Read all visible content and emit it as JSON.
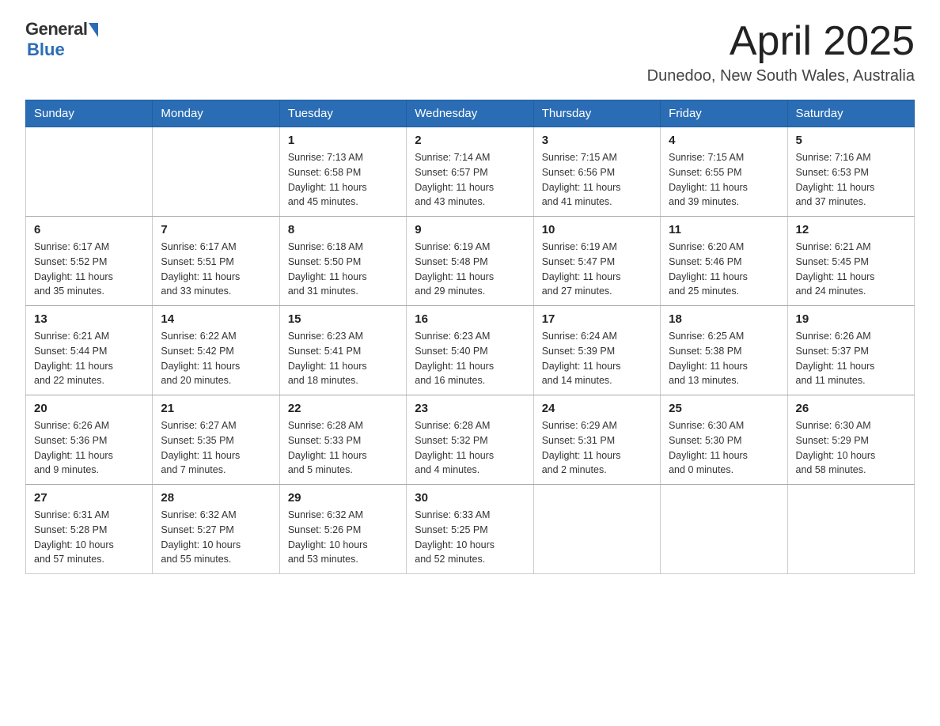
{
  "header": {
    "logo_general": "General",
    "logo_blue": "Blue",
    "title": "April 2025",
    "location": "Dunedoo, New South Wales, Australia"
  },
  "weekdays": [
    "Sunday",
    "Monday",
    "Tuesday",
    "Wednesday",
    "Thursday",
    "Friday",
    "Saturday"
  ],
  "weeks": [
    [
      {
        "day": "",
        "info": ""
      },
      {
        "day": "",
        "info": ""
      },
      {
        "day": "1",
        "info": "Sunrise: 7:13 AM\nSunset: 6:58 PM\nDaylight: 11 hours\nand 45 minutes."
      },
      {
        "day": "2",
        "info": "Sunrise: 7:14 AM\nSunset: 6:57 PM\nDaylight: 11 hours\nand 43 minutes."
      },
      {
        "day": "3",
        "info": "Sunrise: 7:15 AM\nSunset: 6:56 PM\nDaylight: 11 hours\nand 41 minutes."
      },
      {
        "day": "4",
        "info": "Sunrise: 7:15 AM\nSunset: 6:55 PM\nDaylight: 11 hours\nand 39 minutes."
      },
      {
        "day": "5",
        "info": "Sunrise: 7:16 AM\nSunset: 6:53 PM\nDaylight: 11 hours\nand 37 minutes."
      }
    ],
    [
      {
        "day": "6",
        "info": "Sunrise: 6:17 AM\nSunset: 5:52 PM\nDaylight: 11 hours\nand 35 minutes."
      },
      {
        "day": "7",
        "info": "Sunrise: 6:17 AM\nSunset: 5:51 PM\nDaylight: 11 hours\nand 33 minutes."
      },
      {
        "day": "8",
        "info": "Sunrise: 6:18 AM\nSunset: 5:50 PM\nDaylight: 11 hours\nand 31 minutes."
      },
      {
        "day": "9",
        "info": "Sunrise: 6:19 AM\nSunset: 5:48 PM\nDaylight: 11 hours\nand 29 minutes."
      },
      {
        "day": "10",
        "info": "Sunrise: 6:19 AM\nSunset: 5:47 PM\nDaylight: 11 hours\nand 27 minutes."
      },
      {
        "day": "11",
        "info": "Sunrise: 6:20 AM\nSunset: 5:46 PM\nDaylight: 11 hours\nand 25 minutes."
      },
      {
        "day": "12",
        "info": "Sunrise: 6:21 AM\nSunset: 5:45 PM\nDaylight: 11 hours\nand 24 minutes."
      }
    ],
    [
      {
        "day": "13",
        "info": "Sunrise: 6:21 AM\nSunset: 5:44 PM\nDaylight: 11 hours\nand 22 minutes."
      },
      {
        "day": "14",
        "info": "Sunrise: 6:22 AM\nSunset: 5:42 PM\nDaylight: 11 hours\nand 20 minutes."
      },
      {
        "day": "15",
        "info": "Sunrise: 6:23 AM\nSunset: 5:41 PM\nDaylight: 11 hours\nand 18 minutes."
      },
      {
        "day": "16",
        "info": "Sunrise: 6:23 AM\nSunset: 5:40 PM\nDaylight: 11 hours\nand 16 minutes."
      },
      {
        "day": "17",
        "info": "Sunrise: 6:24 AM\nSunset: 5:39 PM\nDaylight: 11 hours\nand 14 minutes."
      },
      {
        "day": "18",
        "info": "Sunrise: 6:25 AM\nSunset: 5:38 PM\nDaylight: 11 hours\nand 13 minutes."
      },
      {
        "day": "19",
        "info": "Sunrise: 6:26 AM\nSunset: 5:37 PM\nDaylight: 11 hours\nand 11 minutes."
      }
    ],
    [
      {
        "day": "20",
        "info": "Sunrise: 6:26 AM\nSunset: 5:36 PM\nDaylight: 11 hours\nand 9 minutes."
      },
      {
        "day": "21",
        "info": "Sunrise: 6:27 AM\nSunset: 5:35 PM\nDaylight: 11 hours\nand 7 minutes."
      },
      {
        "day": "22",
        "info": "Sunrise: 6:28 AM\nSunset: 5:33 PM\nDaylight: 11 hours\nand 5 minutes."
      },
      {
        "day": "23",
        "info": "Sunrise: 6:28 AM\nSunset: 5:32 PM\nDaylight: 11 hours\nand 4 minutes."
      },
      {
        "day": "24",
        "info": "Sunrise: 6:29 AM\nSunset: 5:31 PM\nDaylight: 11 hours\nand 2 minutes."
      },
      {
        "day": "25",
        "info": "Sunrise: 6:30 AM\nSunset: 5:30 PM\nDaylight: 11 hours\nand 0 minutes."
      },
      {
        "day": "26",
        "info": "Sunrise: 6:30 AM\nSunset: 5:29 PM\nDaylight: 10 hours\nand 58 minutes."
      }
    ],
    [
      {
        "day": "27",
        "info": "Sunrise: 6:31 AM\nSunset: 5:28 PM\nDaylight: 10 hours\nand 57 minutes."
      },
      {
        "day": "28",
        "info": "Sunrise: 6:32 AM\nSunset: 5:27 PM\nDaylight: 10 hours\nand 55 minutes."
      },
      {
        "day": "29",
        "info": "Sunrise: 6:32 AM\nSunset: 5:26 PM\nDaylight: 10 hours\nand 53 minutes."
      },
      {
        "day": "30",
        "info": "Sunrise: 6:33 AM\nSunset: 5:25 PM\nDaylight: 10 hours\nand 52 minutes."
      },
      {
        "day": "",
        "info": ""
      },
      {
        "day": "",
        "info": ""
      },
      {
        "day": "",
        "info": ""
      }
    ]
  ]
}
